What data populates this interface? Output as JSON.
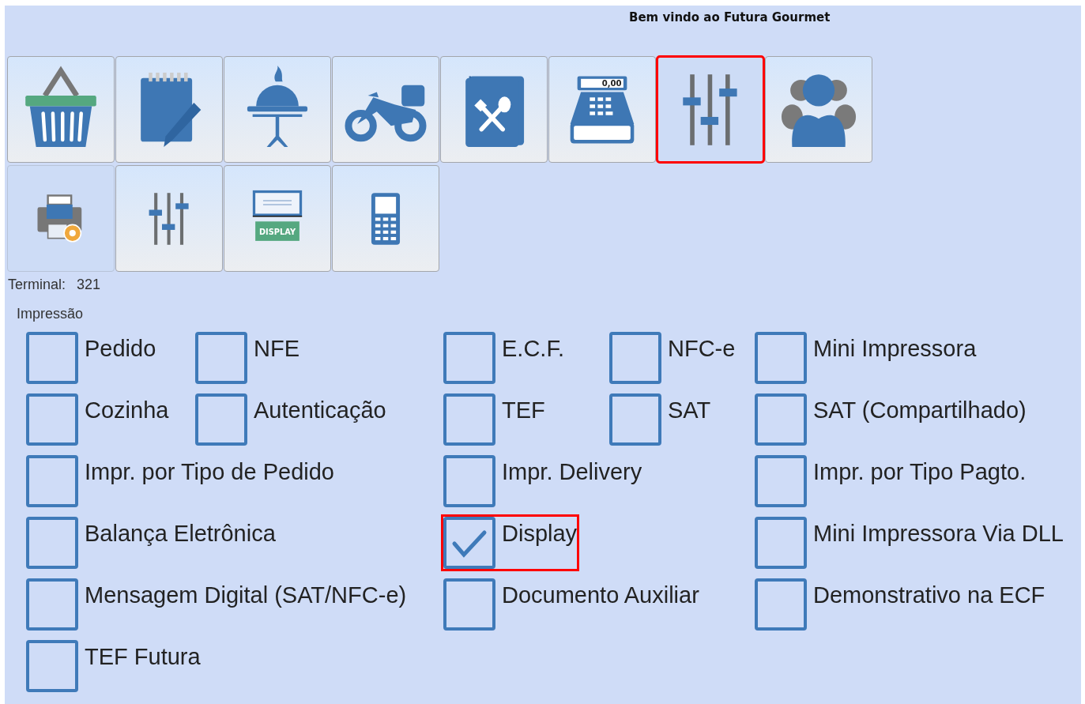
{
  "header": {
    "title": "Bem vindo ao Futura Gourmet"
  },
  "toolbar_rows": [
    [
      {
        "kind": "basket",
        "selected": false,
        "highlighted": false
      },
      {
        "kind": "notepad",
        "selected": false,
        "highlighted": false
      },
      {
        "kind": "cloche",
        "selected": false,
        "highlighted": false
      },
      {
        "kind": "motorcycle",
        "selected": false,
        "highlighted": false
      },
      {
        "kind": "menu",
        "selected": false,
        "highlighted": false
      },
      {
        "kind": "register",
        "selected": false,
        "highlighted": false,
        "caption": "0,00"
      },
      {
        "kind": "sliders",
        "selected": true,
        "highlighted": true
      },
      {
        "kind": "users",
        "selected": false,
        "highlighted": false
      }
    ],
    [
      {
        "kind": "printer",
        "selected": true,
        "highlighted": false
      },
      {
        "kind": "sliders",
        "selected": false,
        "highlighted": false
      },
      {
        "kind": "display",
        "selected": false,
        "highlighted": false,
        "caption": "DISPLAY"
      },
      {
        "kind": "phone",
        "selected": false,
        "highlighted": false
      }
    ]
  ],
  "terminal": {
    "label": "Terminal:",
    "value": "321"
  },
  "group": {
    "title": "Impressão",
    "rows": [
      [
        {
          "label": "Pedido",
          "checked": false,
          "highlighted": false
        },
        {
          "label": "NFE",
          "checked": false,
          "highlighted": false
        },
        {
          "label": "E.C.F.",
          "checked": false,
          "highlighted": false
        },
        {
          "label": "NFC-e",
          "checked": false,
          "highlighted": false
        },
        {
          "label": "Mini Impressora",
          "checked": false,
          "highlighted": false
        }
      ],
      [
        {
          "label": "Cozinha",
          "checked": false,
          "highlighted": false
        },
        {
          "label": "Autenticação",
          "checked": false,
          "highlighted": false
        },
        {
          "label": "TEF",
          "checked": false,
          "highlighted": false
        },
        {
          "label": "SAT",
          "checked": false,
          "highlighted": false
        },
        {
          "label": "SAT (Compartilhado)",
          "checked": false,
          "highlighted": false
        }
      ],
      [
        {
          "label": "Impr. por Tipo de Pedido",
          "checked": false,
          "highlighted": false
        },
        {
          "label": "Impr. Delivery",
          "checked": false,
          "highlighted": false
        },
        {
          "label": "Impr. por Tipo Pagto.",
          "checked": false,
          "highlighted": false
        }
      ],
      [
        {
          "label": "Balança Eletrônica",
          "checked": false,
          "highlighted": false
        },
        {
          "label": "Display",
          "checked": true,
          "highlighted": true
        },
        {
          "label": "Mini Impressora Via DLL",
          "checked": false,
          "highlighted": false
        }
      ],
      [
        {
          "label": "Mensagem Digital (SAT/NFC-e)",
          "checked": false,
          "highlighted": false
        },
        {
          "label": "Documento Auxiliar",
          "checked": false,
          "highlighted": false
        },
        {
          "label": "Demonstrativo na ECF",
          "checked": false,
          "highlighted": false
        }
      ],
      [
        {
          "label": "TEF Futura",
          "checked": false,
          "highlighted": false
        }
      ]
    ]
  }
}
